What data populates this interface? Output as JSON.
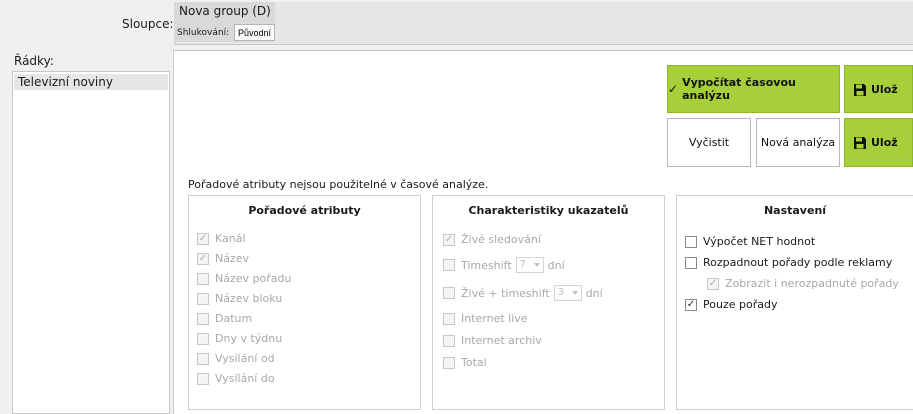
{
  "header": {
    "columns_label": "Sloupce:",
    "group_title": "Nova group (D)",
    "clustering_label": "Shlukování:",
    "clustering_button": "Původní"
  },
  "rows": {
    "label": "Řádky:",
    "items": [
      "Televizní noviny"
    ]
  },
  "actions": {
    "compute": "Vypočítat časovou analýzu",
    "compute_icon": "check-icon",
    "save": "Ulož",
    "save_icon": "floppy-disk-icon",
    "clear": "Vyčistit",
    "new_analysis": "Nová analýza",
    "save2": "Ulož"
  },
  "note": "Pořadové atributy nejsou použitelné v časové analýze.",
  "groups": {
    "attrs": {
      "title": "Pořadové atributy",
      "items": [
        {
          "label": "Kanál",
          "checked": true
        },
        {
          "label": "Název",
          "checked": true
        },
        {
          "label": "Název pořadu",
          "checked": false
        },
        {
          "label": "Název bloku",
          "checked": false
        },
        {
          "label": "Datum",
          "checked": false
        },
        {
          "label": "Dny v týdnu",
          "checked": false
        },
        {
          "label": "Vysílání od",
          "checked": false
        },
        {
          "label": "Vysílání do",
          "checked": false
        }
      ]
    },
    "indicators": {
      "title": "Charakteristiky ukazatelů",
      "live": "Živé sledování",
      "timeshift": "Timeshift",
      "timeshift_value": "7",
      "timeshift_unit": "dní",
      "live_timeshift": "Živé + timeshift",
      "live_timeshift_value": "3",
      "live_timeshift_unit": "dní",
      "internet_live": "Internet live",
      "internet_archive": "Internet archiv",
      "total": "Total"
    },
    "settings": {
      "title": "Nastavení",
      "net": "Výpočet NET hodnot",
      "split": "Rozpadnout pořady podle reklamy",
      "show_unsplit": "Zobrazit i nerozpadnuté pořady",
      "only_programs": "Pouze pořady"
    }
  }
}
